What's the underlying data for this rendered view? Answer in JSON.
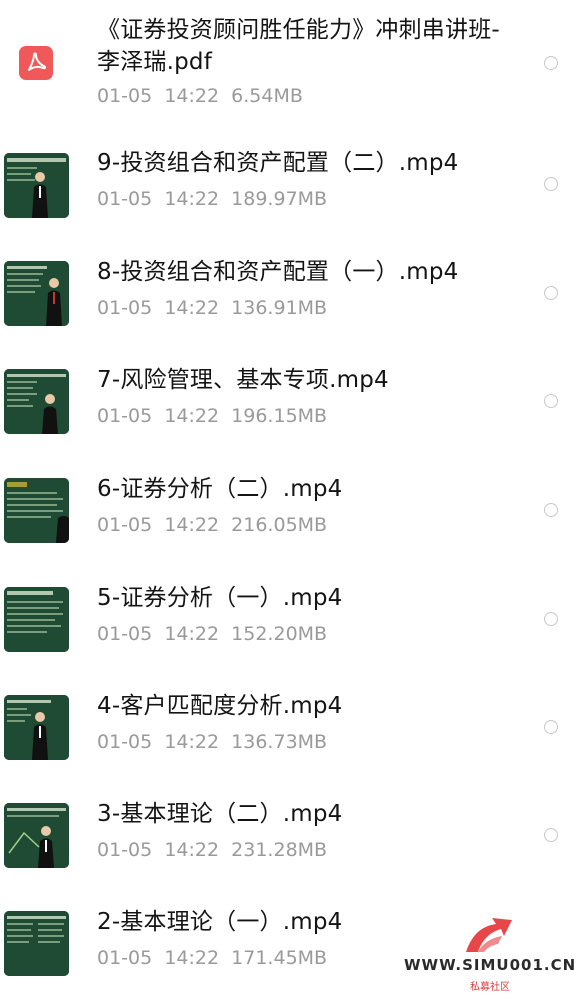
{
  "files": [
    {
      "name": "《证券投资顾问胜任能力》冲刺串讲班-李泽瑞.pdf",
      "date": "01-05",
      "time": "14:22",
      "size": "6.54MB",
      "icon": "pdf-icon"
    },
    {
      "name": "9-投资组合和资产配置（二）.mp4",
      "date": "01-05",
      "time": "14:22",
      "size": "189.97MB",
      "icon": "video-thumbnail"
    },
    {
      "name": "8-投资组合和资产配置（一）.mp4",
      "date": "01-05",
      "time": "14:22",
      "size": "136.91MB",
      "icon": "video-thumbnail"
    },
    {
      "name": "7-风险管理、基本专项.mp4",
      "date": "01-05",
      "time": "14:22",
      "size": "196.15MB",
      "icon": "video-thumbnail"
    },
    {
      "name": "6-证券分析（二）.mp4",
      "date": "01-05",
      "time": "14:22",
      "size": "216.05MB",
      "icon": "video-thumbnail"
    },
    {
      "name": "5-证券分析（一）.mp4",
      "date": "01-05",
      "time": "14:22",
      "size": "152.20MB",
      "icon": "video-thumbnail"
    },
    {
      "name": "4-客户匹配度分析.mp4",
      "date": "01-05",
      "time": "14:22",
      "size": "136.73MB",
      "icon": "video-thumbnail"
    },
    {
      "name": "3-基本理论（二）.mp4",
      "date": "01-05",
      "time": "14:22",
      "size": "231.28MB",
      "icon": "video-thumbnail"
    },
    {
      "name": "2-基本理论（一）.mp4",
      "date": "01-05",
      "time": "14:22",
      "size": "171.45MB",
      "icon": "video-thumbnail"
    }
  ],
  "watermark": {
    "site": "WWW.SIMU001.CN",
    "subtitle": "私募社区"
  },
  "colors": {
    "pdf_icon": "#f0585a",
    "name_text": "#141414",
    "meta_text": "#9a9a9a",
    "radio_border": "#c9c9c9",
    "thumbnail_board": "#1f4a33"
  }
}
